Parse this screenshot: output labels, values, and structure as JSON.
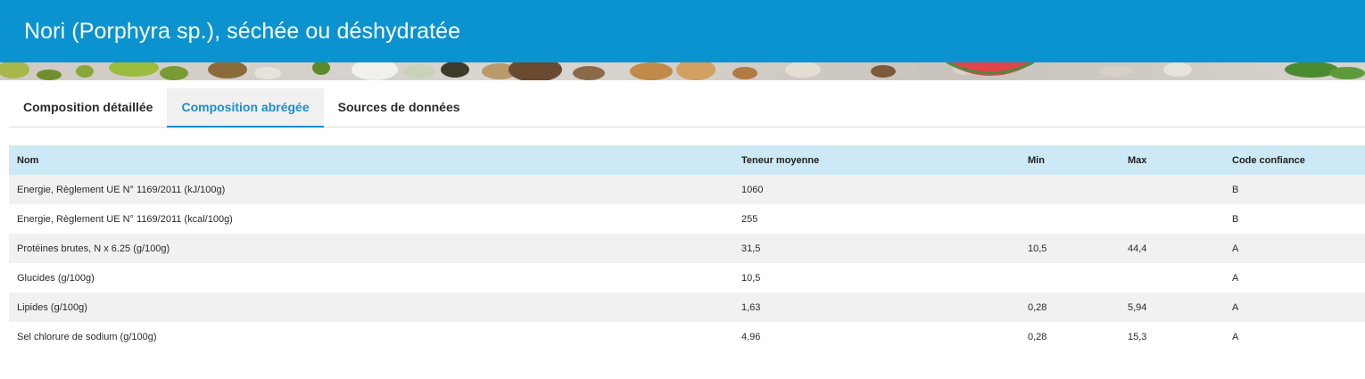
{
  "page": {
    "title": "Nori (Porphyra sp.), séchée ou déshydratée"
  },
  "tabs": [
    {
      "label": "Composition détaillée",
      "active": false
    },
    {
      "label": "Composition abrégée",
      "active": true
    },
    {
      "label": "Sources de données",
      "active": false
    }
  ],
  "table": {
    "headers": {
      "name": "Nom",
      "mean": "Teneur moyenne",
      "min": "Min",
      "max": "Max",
      "code": "Code confiance"
    },
    "rows": [
      {
        "name": "Energie, Règlement UE N° 1169/2011 (kJ/100g)",
        "mean": "1060",
        "min": "",
        "max": "",
        "code": "B"
      },
      {
        "name": "Energie, Règlement UE N° 1169/2011 (kcal/100g)",
        "mean": "255",
        "min": "",
        "max": "",
        "code": "B"
      },
      {
        "name": "Protéines brutes, N x 6.25 (g/100g)",
        "mean": "31,5",
        "min": "10,5",
        "max": "44,4",
        "code": "A"
      },
      {
        "name": "Glucides (g/100g)",
        "mean": "10,5",
        "min": "",
        "max": "",
        "code": "A"
      },
      {
        "name": "Lipides (g/100g)",
        "mean": "1,63",
        "min": "0,28",
        "max": "5,94",
        "code": "A"
      },
      {
        "name": "Sel chlorure de sodium (g/100g)",
        "mean": "4,96",
        "min": "0,28",
        "max": "15,3",
        "code": "A"
      }
    ]
  },
  "colors": {
    "header_bar": "#0b93d0",
    "active_tab": "#1a8fd0",
    "table_header": "#cce9f5",
    "row_stripe": "#f1f1f1"
  }
}
